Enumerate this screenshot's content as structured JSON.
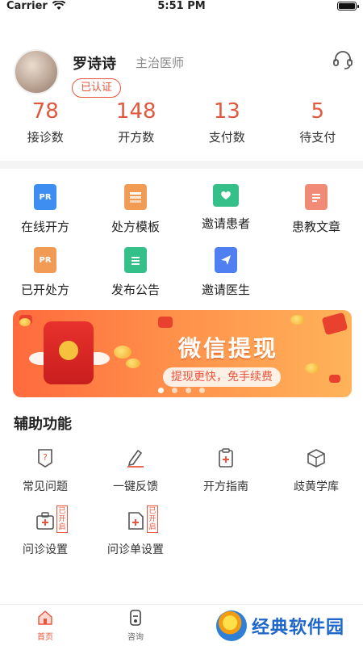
{
  "status_bar": {
    "carrier": "Carrier",
    "time": "5:51 PM"
  },
  "profile": {
    "name": "罗诗诗",
    "title": "主治医师",
    "badge": "已认证"
  },
  "stats": [
    {
      "value": "78",
      "label": "接诊数"
    },
    {
      "value": "148",
      "label": "开方数"
    },
    {
      "value": "13",
      "label": "支付数"
    },
    {
      "value": "5",
      "label": "待支付"
    }
  ],
  "features_row1": [
    {
      "label": "在线开方",
      "icon": "prescription-icon",
      "color": "#3d8ef0",
      "icon_text": "PR"
    },
    {
      "label": "处方模板",
      "icon": "template-icon",
      "color": "#f29b55"
    },
    {
      "label": "邀请患者",
      "icon": "invite-patient-icon",
      "color": "#35c08a"
    },
    {
      "label": "患教文章",
      "icon": "article-icon",
      "color": "#f28a78"
    }
  ],
  "features_row2": [
    {
      "label": "已开处方",
      "icon": "issued-prescription-icon",
      "color": "#f29b55",
      "icon_text": "PR"
    },
    {
      "label": "发布公告",
      "icon": "announcement-icon",
      "color": "#35c08a"
    },
    {
      "label": "邀请医生",
      "icon": "invite-doctor-icon",
      "color": "#4f7ff0"
    }
  ],
  "banner": {
    "title": "微信提现",
    "subtitle": "提现更快，免手续费"
  },
  "aux_section": {
    "title": "辅助功能"
  },
  "tools_row1": [
    {
      "label": "常见问题",
      "icon": "faq-icon"
    },
    {
      "label": "一键反馈",
      "icon": "feedback-icon"
    },
    {
      "label": "开方指南",
      "icon": "guide-icon"
    },
    {
      "label": "歧黄学库",
      "icon": "library-icon"
    }
  ],
  "tools_row2": [
    {
      "label": "问诊设置",
      "icon": "consult-settings-icon",
      "tag": "已开启"
    },
    {
      "label": "问诊单设置",
      "icon": "form-settings-icon",
      "tag": "已开启"
    }
  ],
  "tabbar": [
    {
      "label": "首页",
      "icon": "home-icon",
      "active": true
    },
    {
      "label": "咨询",
      "icon": "consult-icon",
      "active": false
    }
  ],
  "watermark": {
    "text": "经典软件园"
  },
  "colors": {
    "accent": "#e8553e",
    "stat": "#e0593f"
  }
}
